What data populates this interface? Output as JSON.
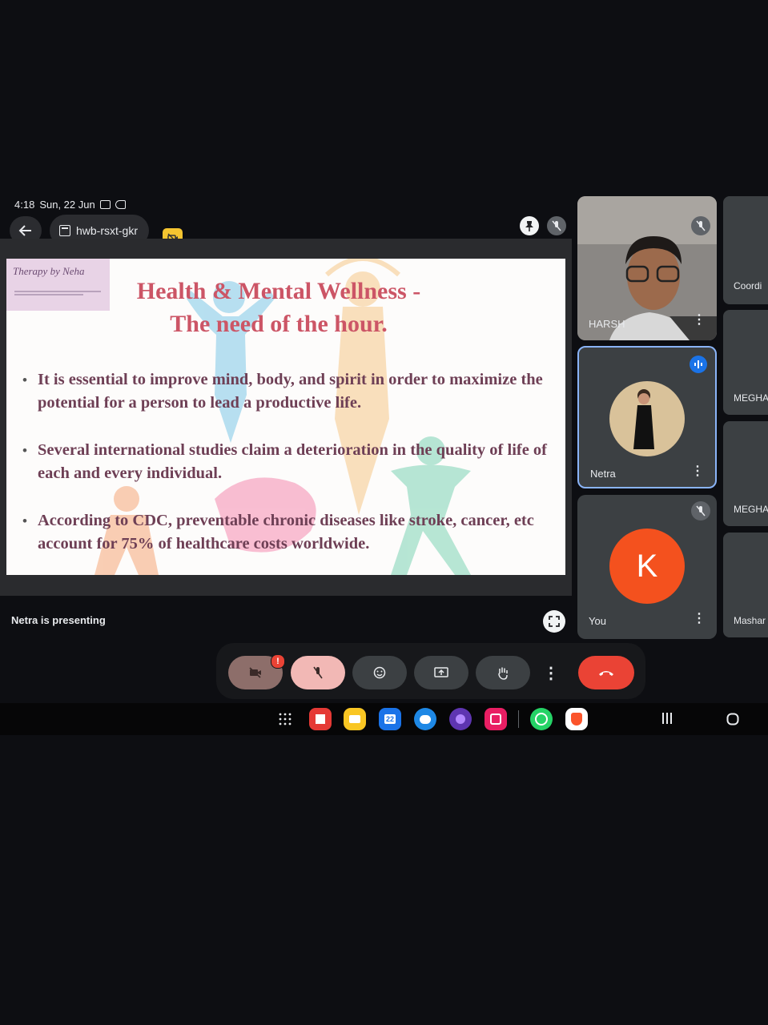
{
  "status_bar": {
    "time": "4:18",
    "date": "Sun, 22 Jun"
  },
  "top_bar": {
    "meeting_code": "hwb-rsxt-gkr"
  },
  "slide": {
    "logo_text": "Therapy by Neha",
    "title_line1": "Health & Mental Wellness -",
    "title_line2": "The need of the hour.",
    "bullets": [
      "It is essential to improve mind, body, and spirit in order to maximize the potential for a person to lead a productive life.",
      "Several international studies claim a deterioration in the quality of life of each and every individual.",
      "According to CDC, preventable chronic diseases like stroke, cancer, etc account for 75% of healthcare costs worldwide."
    ]
  },
  "presenting_label": "Netra is presenting",
  "participants": [
    {
      "name": "HARSH",
      "muted": true
    },
    {
      "name": "Netra",
      "speaking": true
    },
    {
      "name": "You",
      "avatar_letter": "K",
      "avatar_color": "#f4511e",
      "muted": true
    }
  ],
  "side_participants": [
    "Coordi",
    "MEGHA",
    "MEGHA",
    "Mashar"
  ],
  "controls": {
    "camera_color": "#8d6e6a",
    "mic_color": "#f2b8b5",
    "end_call_color": "#ea4335",
    "alert_badge": "!"
  },
  "taskbar": {
    "calendar_day": "22"
  },
  "icons": [
    "back-arrow-icon",
    "calendar-icon",
    "camera-off-icon",
    "pin-icon",
    "mic-off-icon",
    "fullscreen-icon",
    "more-vert-icon",
    "emoji-icon",
    "present-icon",
    "raise-hand-icon",
    "end-call-icon",
    "app-grid-icon",
    "recents-icon",
    "home-icon"
  ]
}
